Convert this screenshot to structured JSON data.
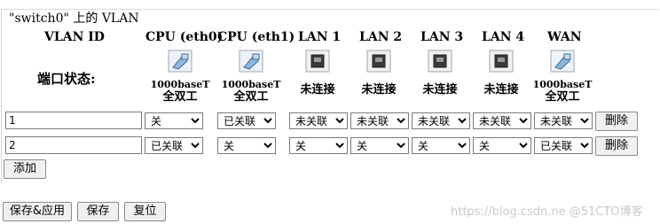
{
  "legend": "\"switch0\" 上的 VLAN",
  "headers": {
    "vlan_id": "VLAN ID",
    "cpu0": "CPU (eth0)",
    "cpu1": "CPU (eth1)",
    "lan1": "LAN 1",
    "lan2": "LAN 2",
    "lan3": "LAN 3",
    "lan4": "LAN 4",
    "wan": "WAN"
  },
  "port_status_label": "端口状态:",
  "ports": {
    "cpu0": {
      "speed": "1000baseT",
      "duplex": "全双工",
      "icon": "ethernet-connected-icon"
    },
    "cpu1": {
      "speed": "1000baseT",
      "duplex": "全双工",
      "icon": "ethernet-connected-icon"
    },
    "lan1": {
      "status": "未连接",
      "icon": "ethernet-disconnected-icon"
    },
    "lan2": {
      "status": "未连接",
      "icon": "ethernet-disconnected-icon"
    },
    "lan3": {
      "status": "未连接",
      "icon": "ethernet-disconnected-icon"
    },
    "lan4": {
      "status": "未连接",
      "icon": "ethernet-disconnected-icon"
    },
    "wan": {
      "speed": "1000baseT",
      "duplex": "全双工",
      "icon": "ethernet-connected-icon"
    }
  },
  "rows": [
    {
      "vid": "1",
      "cpu0": "关",
      "cpu1": "已关联",
      "lan1": "未关联",
      "lan2": "未关联",
      "lan3": "未关联",
      "lan4": "未关联",
      "wan": "未关联",
      "delete": "删除"
    },
    {
      "vid": "2",
      "cpu0": "已关联",
      "cpu1": "关",
      "lan1": "关",
      "lan2": "关",
      "lan3": "关",
      "lan4": "关",
      "wan": "已关联",
      "delete": "删除"
    }
  ],
  "buttons": {
    "add": "添加",
    "save_apply": "保存&应用",
    "save": "保存",
    "reset": "复位"
  },
  "watermark": "https://blog.csdn.ne @51CTO博客"
}
